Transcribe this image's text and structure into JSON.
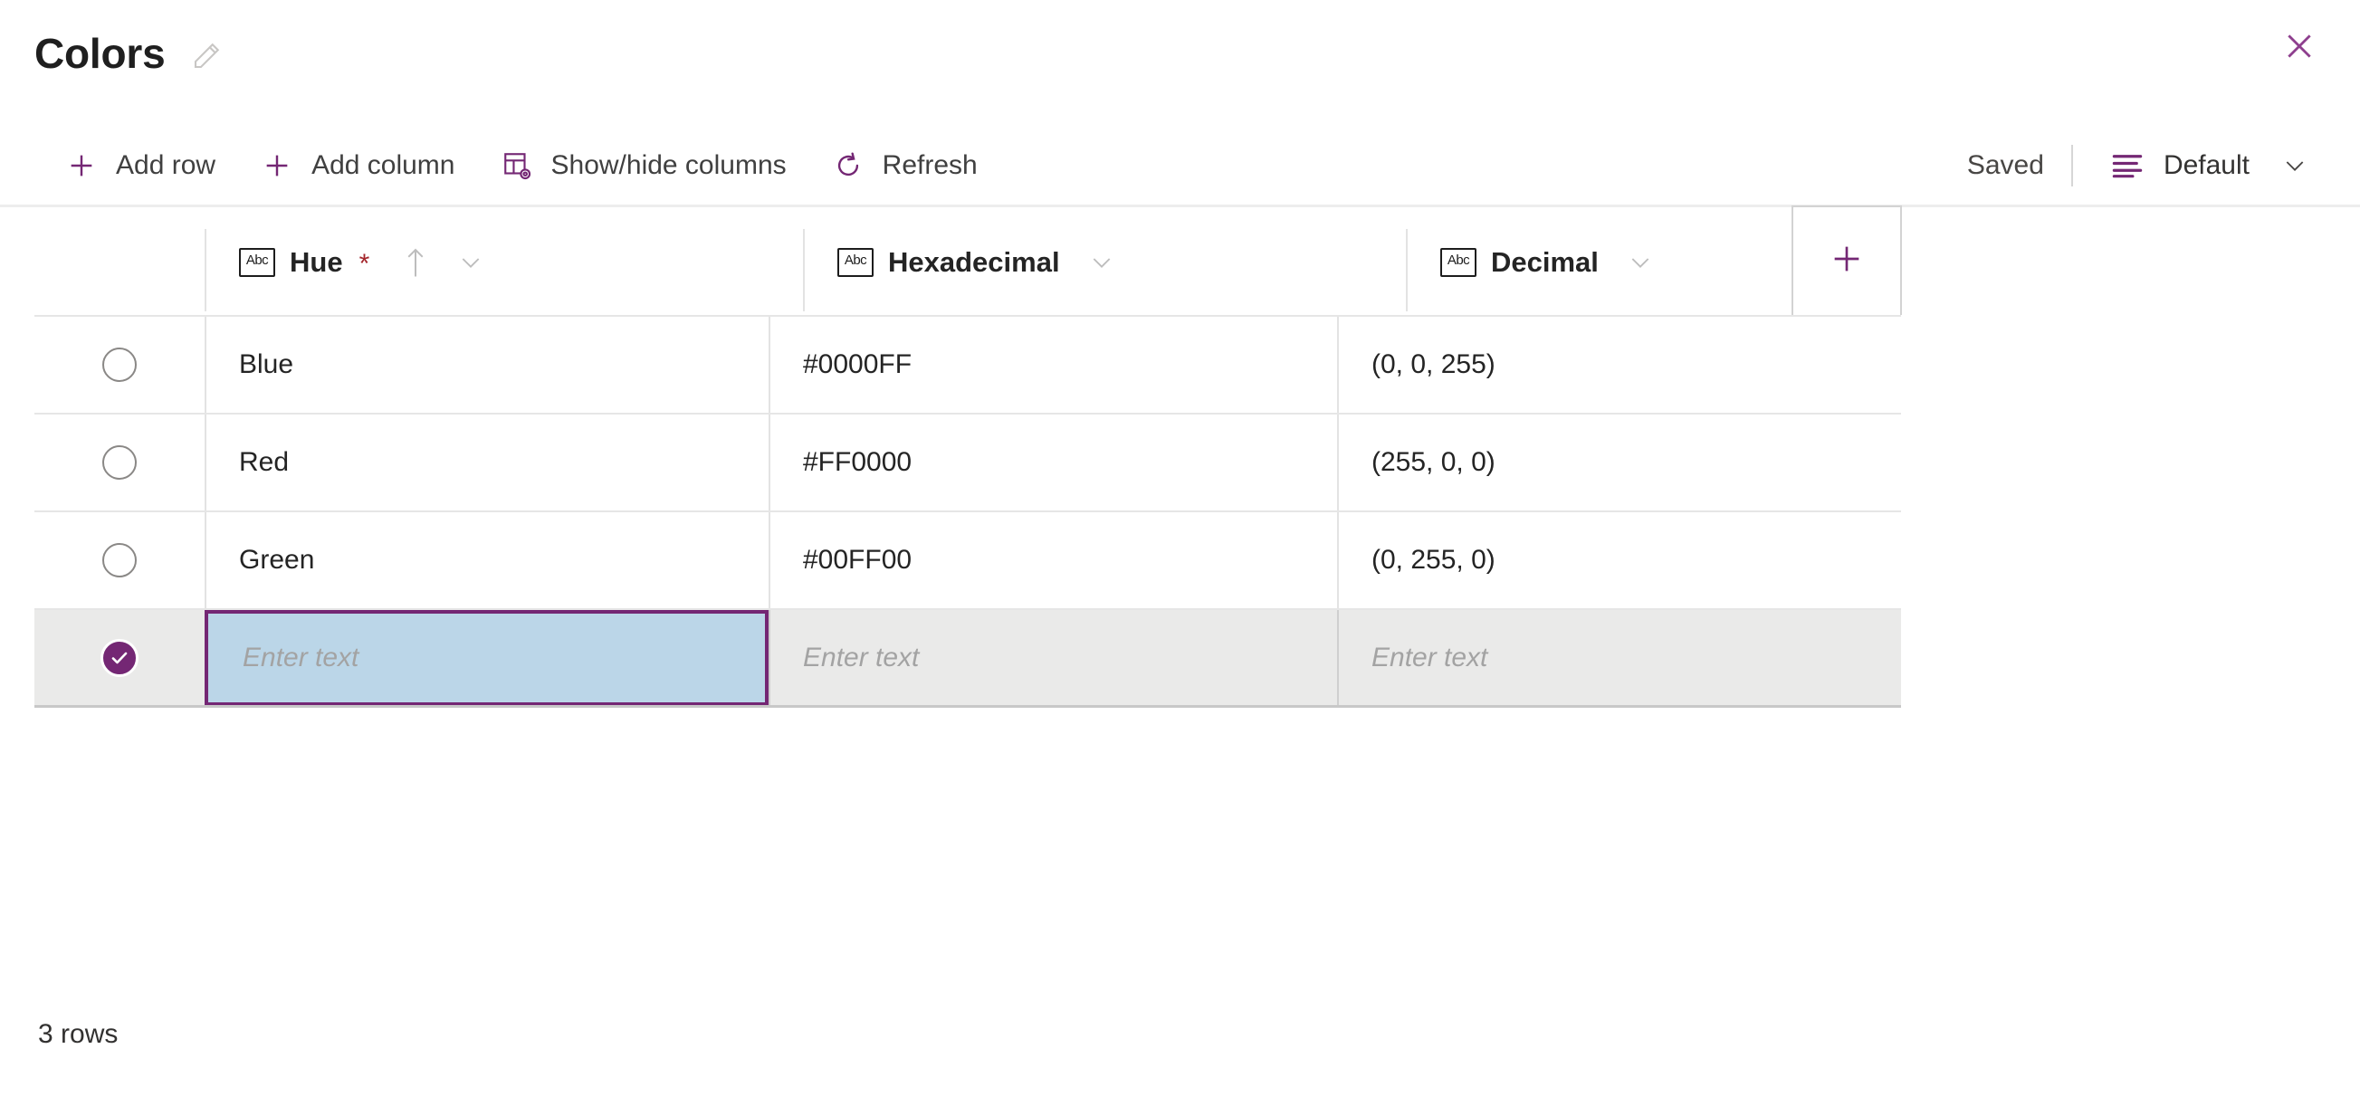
{
  "header": {
    "title": "Colors",
    "edit_icon": "pencil-icon",
    "close_icon": "close-icon"
  },
  "toolbar": {
    "buttons": [
      {
        "label": "Add row",
        "icon": "plus-icon"
      },
      {
        "label": "Add column",
        "icon": "plus-icon"
      },
      {
        "label": "Show/hide columns",
        "icon": "table-settings-icon"
      },
      {
        "label": "Refresh",
        "icon": "refresh-icon"
      }
    ],
    "status": "Saved",
    "view": {
      "label": "Default",
      "icon": "view-list-icon",
      "chevron": "chevron-down-icon"
    }
  },
  "grid": {
    "columns": [
      {
        "label": "Hue",
        "type_icon": "abc-icon",
        "required": true,
        "required_marker": "*",
        "sorted": true,
        "sort_icon": "sort-ascending-icon",
        "menu_icon": "chevron-down-icon"
      },
      {
        "label": "Hexadecimal",
        "type_icon": "abc-icon",
        "required": false,
        "sorted": false,
        "menu_icon": "chevron-down-icon"
      },
      {
        "label": "Decimal",
        "type_icon": "abc-icon",
        "required": false,
        "sorted": false,
        "menu_icon": "chevron-down-icon"
      }
    ],
    "add_column_icon": "plus-icon",
    "rows": [
      {
        "selected": false,
        "hue": "Blue",
        "hexadecimal": "#0000FF",
        "decimal": "(0, 0, 255)"
      },
      {
        "selected": false,
        "hue": "Red",
        "hexadecimal": "#FF0000",
        "decimal": "(255, 0, 0)"
      },
      {
        "selected": false,
        "hue": "Green",
        "hexadecimal": "#00FF00",
        "decimal": "(0, 255, 0)"
      }
    ],
    "new_row": {
      "selected": true,
      "placeholder": "Enter text",
      "active_column": "Hue"
    }
  },
  "footer": {
    "row_count_label": "3 rows"
  },
  "colors": {
    "accent_purple": "#742774",
    "active_cell_fill": "#bbd6e8",
    "selected_row_bg": "#eaeae9",
    "required_red": "#a4262c",
    "grid_line": "#e6e6e6",
    "placeholder_gray": "#a3a3a3"
  }
}
